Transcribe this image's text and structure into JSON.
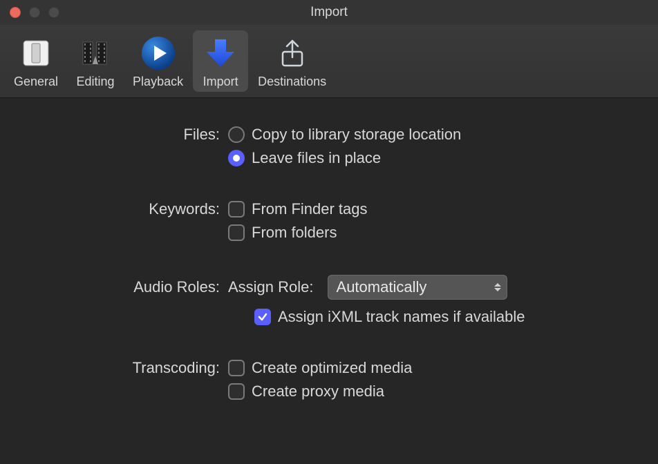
{
  "window": {
    "title": "Import"
  },
  "toolbar": {
    "items": [
      {
        "label": "General"
      },
      {
        "label": "Editing"
      },
      {
        "label": "Playback"
      },
      {
        "label": "Import"
      },
      {
        "label": "Destinations"
      }
    ],
    "selected_index": 3
  },
  "sections": {
    "files": {
      "label": "Files:",
      "options": {
        "copy": "Copy to library storage location",
        "leave": "Leave files in place"
      },
      "selected": "leave"
    },
    "keywords": {
      "label": "Keywords:",
      "finder_tags": {
        "label": "From Finder tags",
        "checked": false
      },
      "from_folders": {
        "label": "From folders",
        "checked": false
      }
    },
    "audio_roles": {
      "label": "Audio Roles:",
      "assign_label": "Assign Role:",
      "assign_value": "Automatically",
      "ixml": {
        "label": "Assign iXML track names if available",
        "checked": true
      }
    },
    "transcoding": {
      "label": "Transcoding:",
      "optimized": {
        "label": "Create optimized media",
        "checked": false
      },
      "proxy": {
        "label": "Create proxy media",
        "checked": false
      }
    }
  }
}
